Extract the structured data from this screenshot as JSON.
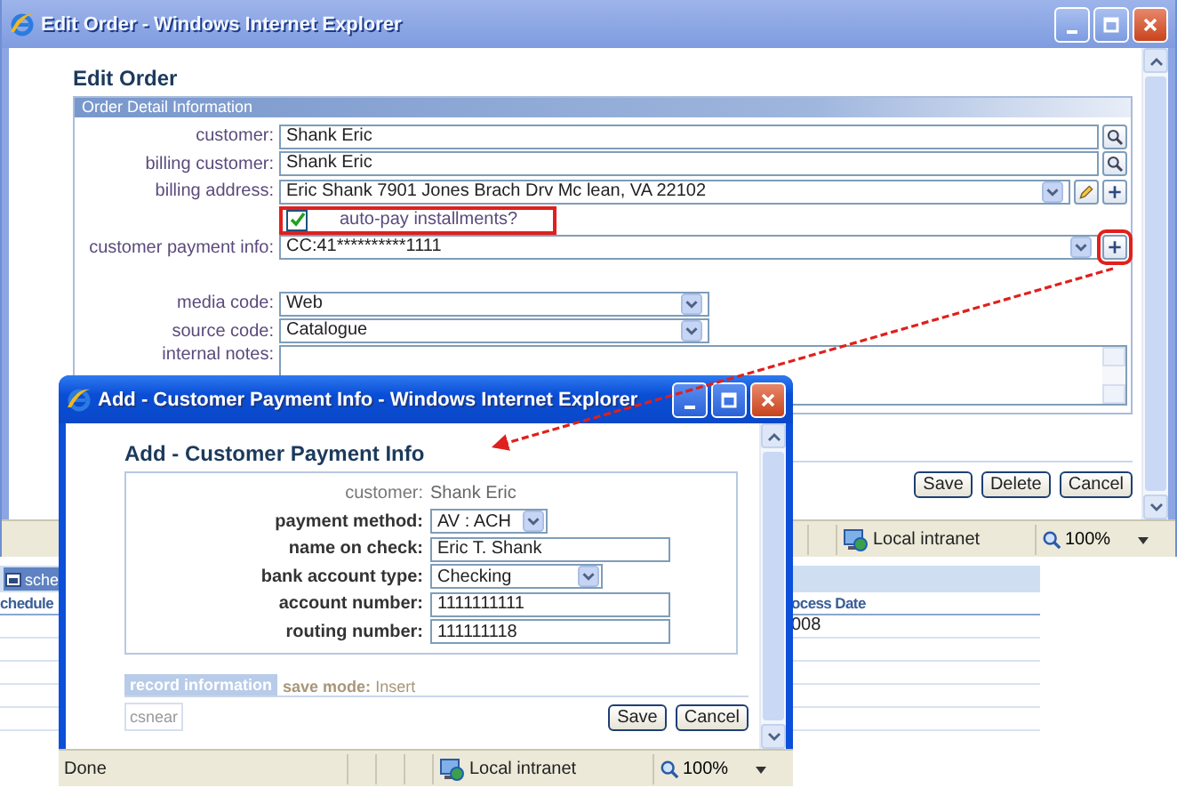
{
  "main_window": {
    "title": "Edit Order - Windows Internet Explorer",
    "heading": "Edit Order",
    "panel_title": "Order Detail Information",
    "fields": [
      {
        "kind": "lookup",
        "label": "customer:",
        "value": "Shank Eric",
        "highlighted": false
      },
      {
        "kind": "lookup",
        "label": "billing customer:",
        "value": "Shank Eric",
        "highlighted": false
      },
      {
        "kind": "select-actions",
        "label": "billing address:",
        "value": "Eric Shank 7901 Jones Brach Drv Mc lean, VA 22102",
        "highlighted": false
      },
      {
        "kind": "checkbox",
        "label": "auto-pay installments?",
        "checked": true,
        "highlighted": true
      },
      {
        "kind": "select-add",
        "label": "customer payment info:",
        "value": "CC:41**********1111",
        "highlighted": true
      },
      {
        "kind": "select",
        "label": "media code:",
        "value": "Web",
        "highlighted": false
      },
      {
        "kind": "select",
        "label": "source code:",
        "value": "Catalogue",
        "highlighted": false
      },
      {
        "kind": "textarea",
        "label": "internal notes:",
        "highlighted": false
      }
    ],
    "buttons": [
      "Save",
      "Delete",
      "Cancel"
    ],
    "status_bar": {
      "zone": "Local intranet",
      "zoom": "100%"
    }
  },
  "background_page": {
    "tab": "sche",
    "left_header": "chedule",
    "right_header": "ocess Date",
    "right_cell": "008"
  },
  "popup_window": {
    "title": "Add - Customer Payment Info - Windows Internet Explorer",
    "heading": "Add - Customer Payment Info",
    "fields": [
      {
        "kind": "readonly",
        "label": "customer:",
        "value": "Shank Eric"
      },
      {
        "kind": "select",
        "label": "payment method:",
        "value": "AV : ACH"
      },
      {
        "kind": "text",
        "label": "name on check:",
        "value": "Eric T. Shank"
      },
      {
        "kind": "select",
        "label": "bank account type:",
        "value": "Checking"
      },
      {
        "kind": "text",
        "label": "account number:",
        "value": "1111111111"
      },
      {
        "kind": "text",
        "label": "routing number:",
        "value": "111111118"
      }
    ],
    "record_tab": "record information",
    "save_mode_label": "save mode:",
    "save_mode": "Insert",
    "user": "csnear",
    "buttons": [
      "Save",
      "Cancel"
    ],
    "status_bar": {
      "text": "Done",
      "zone": "Local intranet",
      "zoom": "100%"
    }
  }
}
